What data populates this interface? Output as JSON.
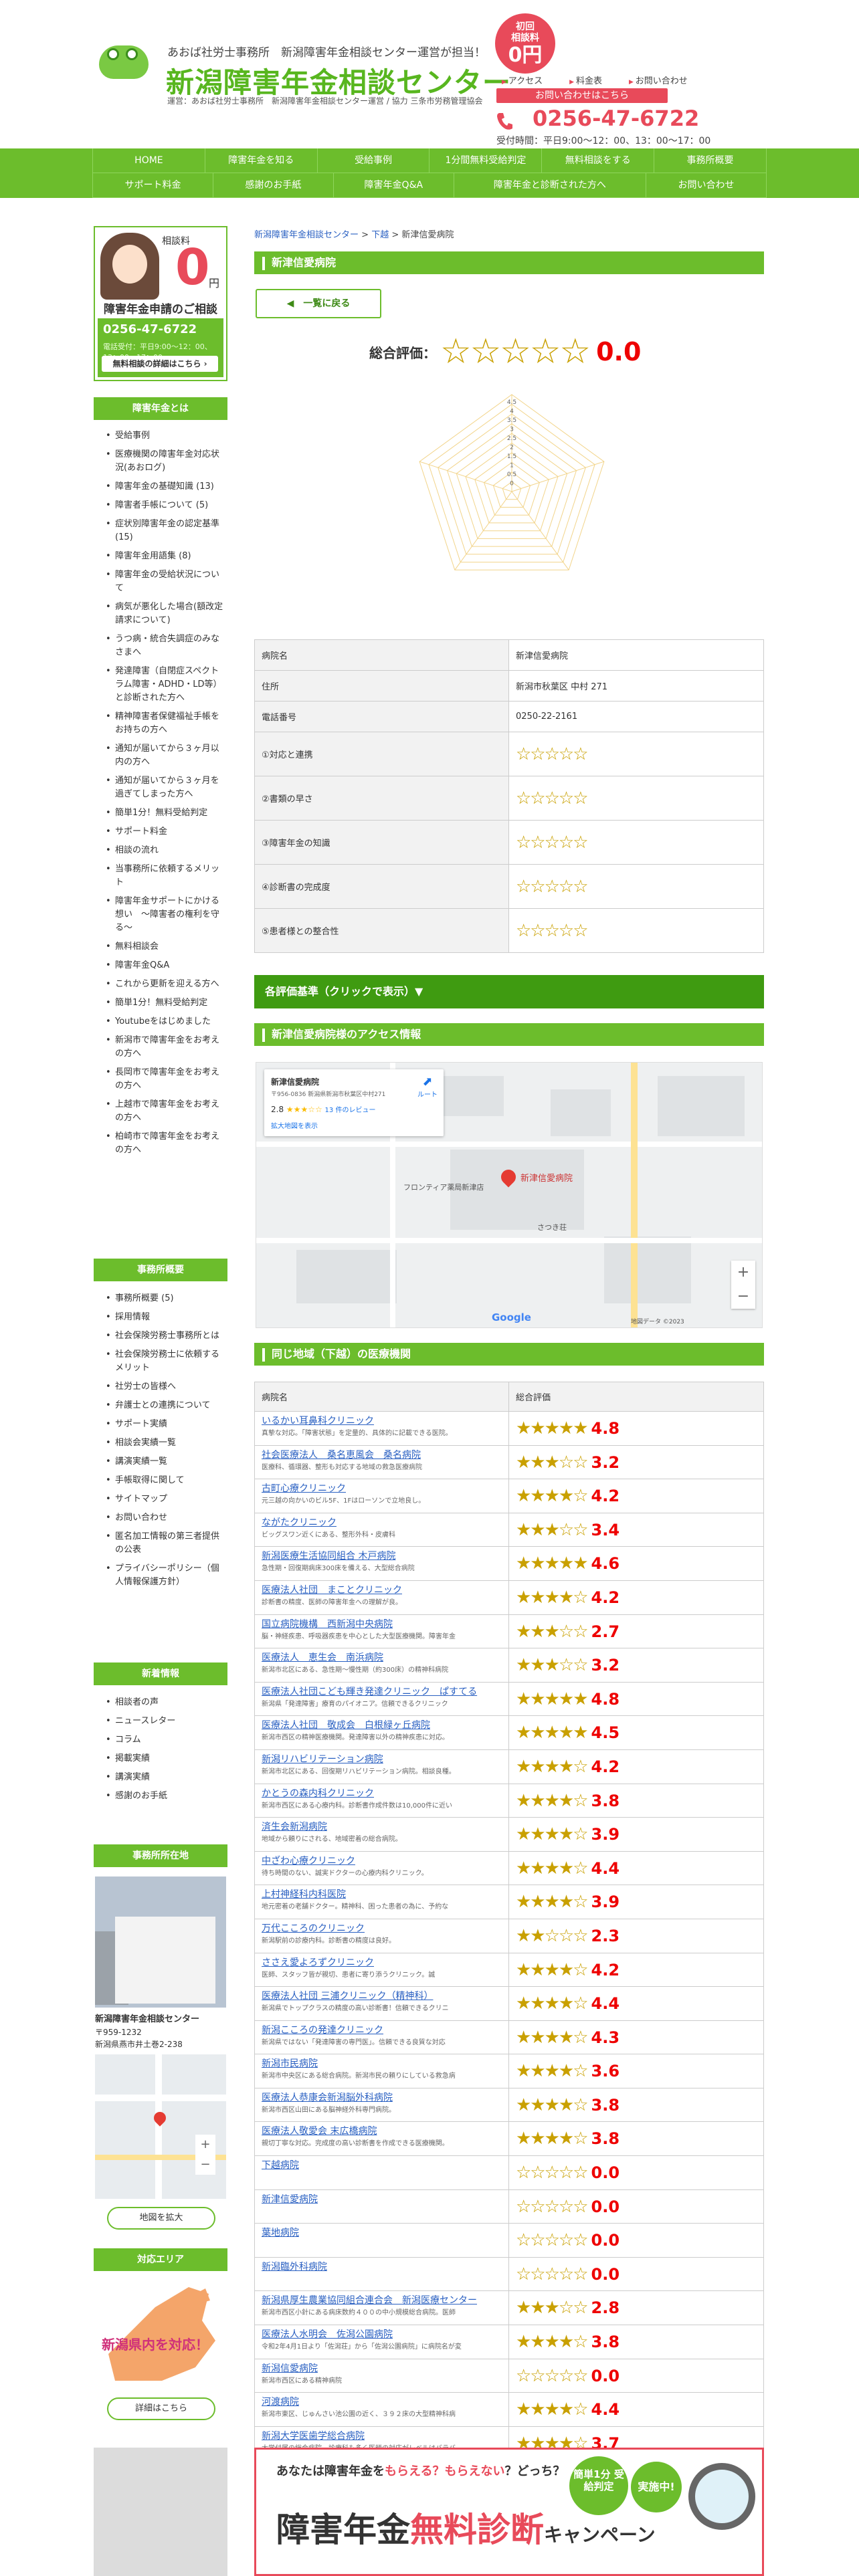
{
  "header": {
    "tagline": "あおば社労士事務所　新潟障害年金相談センター運営が担当！",
    "title": "新潟障害年金相談センター",
    "subline": "運営：あおば社労士事務所　新潟障害年金相談センター運営 / 協力 三条市労務管理協会",
    "badge_line1": "初回",
    "badge_line2": "相談料",
    "badge_price": "0円",
    "links": [
      "アクセス",
      "料金表",
      "お問い合わせ"
    ],
    "contact_button": "お問い合わせはこちら",
    "phone": "0256-47-6722",
    "hours": "受付時間：平日9:00～12：00、13：00～17：00"
  },
  "nav": {
    "row1": [
      "HOME",
      "障害年金を知る",
      "受給事例",
      "1分間無料受給判定",
      "無料相談をする",
      "事務所概要"
    ],
    "row2": [
      "サポート料金",
      "感謝のお手紙",
      "障害年金Q&A",
      "障害年金と診断された方へ",
      "お問い合わせ"
    ]
  },
  "sidebar": {
    "card_label": "相談料",
    "card_price": "0",
    "card_yen": "円",
    "card_heading": "障害年金申請のご相談",
    "card_phone": "0256-47-6722",
    "card_hours": "電話受付：平日9:00～12：00、13：00～17：00",
    "card_button": "無料相談の詳細はこちら ›",
    "section1_title": "障害年金とは",
    "section1_items": [
      "受給事例",
      "医療機関の障害年金対応状況(あおログ)",
      "障害年金の基礎知識 (13)",
      "障害者手帳について (5)",
      "症状別障害年金の認定基準 (15)",
      "障害年金用語集 (8)",
      "障害年金の受給状況について",
      "病気が悪化した場合(額改定請求について)",
      "うつ病・統合失調症のみなさまへ",
      "発達障害（自閉症スペクトラム障害・ADHD・LD等）と診断された方へ",
      "精神障害者保健福祉手帳をお持ちの方へ",
      "通知が届いてから３ヶ月以内の方へ",
      "通知が届いてから３ヶ月を過ぎてしまった方へ",
      "簡単1分！無料受給判定",
      "サポート料金",
      "相談の流れ",
      "当事務所に依頼するメリット",
      "障害年金サポートにかける想い　～障害者の権利を守る～",
      "無料相談会",
      "障害年金Q&A",
      "これから更新を迎える方へ",
      "簡単1分！無料受給判定",
      "Youtubeをはじめました",
      "新潟市で障害年金をお考えの方へ",
      "長岡市で障害年金をお考えの方へ",
      "上越市で障害年金をお考えの方へ",
      "柏崎市で障害年金をお考えの方へ"
    ],
    "section2_title": "事務所概要",
    "section2_items": [
      "事務所概要 (5)",
      "採用情報",
      "社会保険労務士事務所とは",
      "社会保険労務士に依頼するメリット",
      "社労士の皆様へ",
      "弁護士との連携について",
      "サポート実績",
      "相談会実績一覧",
      "講演実績一覧",
      "手帳取得に関して",
      "サイトマップ",
      "お問い合わせ",
      "匿名加工情報の第三者提供の公表",
      "プライバシーポリシー（個人情報保護方針）"
    ],
    "section3_title": "新着情報",
    "section3_items": [
      "相談者の声",
      "ニュースレター",
      "コラム",
      "掲載実績",
      "講演実績",
      "感謝のお手紙"
    ],
    "section4_title": "事務所所在地",
    "office_name": "新潟障害年金相談センター",
    "office_zip": "〒959-1232",
    "office_addr": "新潟県燕市井土巻2-238",
    "map_button": "地図を拡大",
    "section5_title": "対応エリア",
    "area_text": "新潟県内を対応！",
    "area_button": "詳細はこちら"
  },
  "main": {
    "breadcrumb_home": "新潟障害年金相談センター",
    "breadcrumb_sep1": " > ",
    "breadcrumb_mid": "下越",
    "breadcrumb_sep2": " > ",
    "breadcrumb_current": "新津信愛病院",
    "page_title": "新津信愛病院",
    "back_button": "一覧に戻る",
    "score_label": "総合評価：",
    "score_value": "0.0",
    "radar_ticks": [
      "4.5",
      "4",
      "3.5",
      "3",
      "2.5",
      "2",
      "1.5",
      "1",
      "0.5",
      "0"
    ],
    "radar_score_fraction": 0
  },
  "info": [
    {
      "label": "病院名",
      "value": "新津信愛病院"
    },
    {
      "label": "住所",
      "value": "新潟市秋葉区 中村 271"
    },
    {
      "label": "電話番号",
      "value": "0250-22-2161"
    },
    {
      "label": "①対応と連携",
      "value": "☆☆☆☆☆"
    },
    {
      "label": "②書類の早さ",
      "value": "☆☆☆☆☆"
    },
    {
      "label": "③障害年金の知識",
      "value": "☆☆☆☆☆"
    },
    {
      "label": "④診断書の完成度",
      "value": "☆☆☆☆☆"
    },
    {
      "label": "⑤患者様との整合性",
      "value": "☆☆☆☆☆"
    }
  ],
  "criteria_bar": "各評価基準（クリックで表示）▼",
  "access": {
    "title": "新津信愛病院様のアクセス情報",
    "card_name": "新津信愛病院",
    "card_addr": "〒956-0836 新潟県新潟市秋葉区中村271",
    "card_rating": "2.8",
    "card_reviews": "13 件のレビュー",
    "card_link": "拡大地図を表示",
    "directions": "ルート",
    "pin_label": "新津信愛病院",
    "place1": "フロンティア薬局新津店",
    "place2": "さつき荘",
    "google": "Google",
    "attribution": "地図データ ©2023"
  },
  "nearby": {
    "title": "同じ地域（下越）の医療機関",
    "col_name": "病院名",
    "col_rating": "総合評価",
    "rows": [
      {
        "name": "いるかい耳鼻科クリニック",
        "desc": "真摯な対応。「障害状態」を定量的、具体的に記載できる医院。",
        "stars": "★★★★★",
        "score": "4.8"
      },
      {
        "name": "社会医療法人　桑名恵風会　桑名病院",
        "desc": "医療科、循環器、整形も対応する地域の救急医療病院",
        "stars": "★★★☆☆",
        "score": "3.2"
      },
      {
        "name": "古町心療クリニック",
        "desc": "元三越の向かいのビル5F、1Fはローソンで立地良し。",
        "stars": "★★★★☆",
        "score": "4.2"
      },
      {
        "name": "ながたクリニック",
        "desc": "ビッグスワン近くにある、整形外科・皮膚科",
        "stars": "★★★☆☆",
        "score": "3.4"
      },
      {
        "name": "新潟医療生活協同組合 木戸病院",
        "desc": "急性期・回復期病床300床を備える、大型総合病院",
        "stars": "★★★★★",
        "score": "4.6"
      },
      {
        "name": "医療法人社団　まことクリニック",
        "desc": "診断書の精度、医師の障害年金への理解が良。",
        "stars": "★★★★☆",
        "score": "4.2"
      },
      {
        "name": "国立病院機構　西新潟中央病院",
        "desc": "脳・神経疾患、呼吸器疾患を中心とした大型医療機関。障害年金",
        "stars": "★★★☆☆",
        "score": "2.7"
      },
      {
        "name": "医療法人　恵生会　南浜病院",
        "desc": "新潟市北区にある、急性期〜慢性期（約300床）の精神科病院",
        "stars": "★★★☆☆",
        "score": "3.2"
      },
      {
        "name": "医療法人社団こども輝き発達クリニック　ぱすてる",
        "desc": "新潟県「発達障害」療育のパイオニア。信頼できるクリニック",
        "stars": "★★★★★",
        "score": "4.8"
      },
      {
        "name": "医療法人社団　敬成会　白根緑ヶ丘病院",
        "desc": "新潟市西区の精神医療機関。発達障害以外の精神疾患に対応。",
        "stars": "★★★★★",
        "score": "4.5"
      },
      {
        "name": "新潟リハビリテーション病院",
        "desc": "新潟市北区にある、回復期リハビリテーション病院。相談良種。",
        "stars": "★★★★☆",
        "score": "4.2"
      },
      {
        "name": "かとうの森内科クリニック",
        "desc": "新潟市西区にある心療内科。診断書作成件数は10,000件に近い",
        "stars": "★★★★☆",
        "score": "3.8"
      },
      {
        "name": "済生会新潟病院",
        "desc": "地域から頼りにされる、地域密着の総合病院。",
        "stars": "★★★★☆",
        "score": "3.9"
      },
      {
        "name": "中ざわ心療クリニック",
        "desc": "待ち時間のない、誠実ドクターの心療内科クリニック。",
        "stars": "★★★★☆",
        "score": "4.4"
      },
      {
        "name": "上村神経科内科医院",
        "desc": "地元密着の老舗ドクター。精神科、困った患者の為に、予約な",
        "stars": "★★★★☆",
        "score": "3.9"
      },
      {
        "name": "万代こころのクリニック",
        "desc": "新潟駅前の診療内科。診断書の精度は良好。",
        "stars": "★★☆☆☆",
        "score": "2.3"
      },
      {
        "name": "ささえ愛よろずクリニック",
        "desc": "医師、スタッフ皆が親切、患者に寄り添うクリニック。誠",
        "stars": "★★★★☆",
        "score": "4.2"
      },
      {
        "name": "医療法人社団 三浦クリニック（精神科）",
        "desc": "新潟県でトップクラスの精度の高い診断書！信頼できるクリニ",
        "stars": "★★★★☆",
        "score": "4.4"
      },
      {
        "name": "新潟こころの発達クリニック",
        "desc": "新潟県ではない「発達障害の専門医」。信頼できる良質な対応",
        "stars": "★★★★☆",
        "score": "4.3"
      },
      {
        "name": "新潟市民病院",
        "desc": "新潟市中央区にある総合病院。新潟市民の頼りにしている救急病",
        "stars": "★★★★☆",
        "score": "3.6"
      },
      {
        "name": "医療法人恭康会新潟脳外科病院",
        "desc": "新潟市西区山田にある脳神経外科専門病院。",
        "stars": "★★★★☆",
        "score": "3.8"
      },
      {
        "name": "医療法人敬愛会 末広橋病院",
        "desc": "親切丁寧な対応。完成度の高い診断書を作成できる医療機関。",
        "stars": "★★★★☆",
        "score": "3.8"
      },
      {
        "name": "下越病院",
        "desc": "",
        "stars": "☆☆☆☆☆",
        "score": "0.0"
      },
      {
        "name": "新津信愛病院",
        "desc": "",
        "stars": "☆☆☆☆☆",
        "score": "0.0"
      },
      {
        "name": "葉地病院",
        "desc": "",
        "stars": "☆☆☆☆☆",
        "score": "0.0"
      },
      {
        "name": "新潟臨外科病院",
        "desc": "",
        "stars": "☆☆☆☆☆",
        "score": "0.0"
      },
      {
        "name": "新潟県厚生農業協同組合連合会　新潟医療センター",
        "desc": "新潟市西区小針にある病床数約４００の中小規模総合病院。医師",
        "stars": "★★★☆☆",
        "score": "2.8"
      },
      {
        "name": "医療法人水明会　佐潟公園病院",
        "desc": "令和2年4月1日より「佐潟荘」から「佐潟公園病院」に病院名が変",
        "stars": "★★★★☆",
        "score": "3.8"
      },
      {
        "name": "新潟信愛病院",
        "desc": "新潟市西区にある精神病院",
        "stars": "☆☆☆☆☆",
        "score": "0.0"
      },
      {
        "name": "河渡病院",
        "desc": "新潟市東区、じゅんさい池公園の近く、３９２床の大型精神科病",
        "stars": "★★★★☆",
        "score": "4.4"
      },
      {
        "name": "新潟大学医歯学総合病院",
        "desc": "大学付属の総合病院。診療科も多く医師の対応がレベルはバラバ",
        "stars": "★★★★☆",
        "score": "3.7"
      }
    ]
  },
  "banner": {
    "question_pre": "あなたは障害年金を",
    "question_hl": "もらえる？もらえない",
    "question_post": "？どっち？",
    "circle1": "簡単1分 受給判定",
    "circle2": "実施中!",
    "big_pre": "障害年金",
    "big_hl": "無料診断",
    "big_post": "キャンペーン"
  }
}
